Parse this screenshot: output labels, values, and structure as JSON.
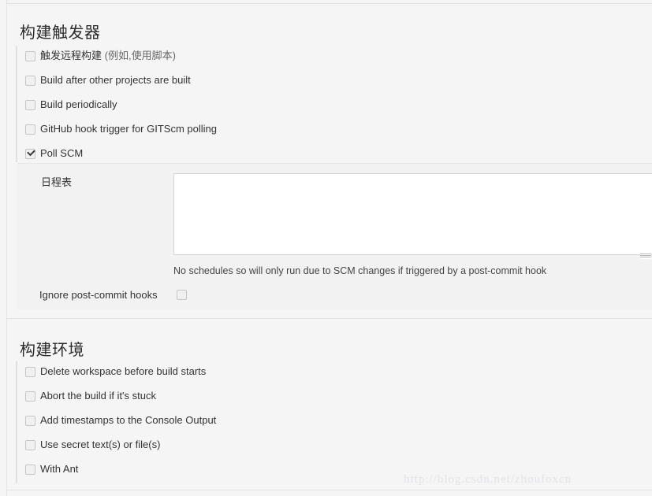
{
  "sections": [
    {
      "heading": "构建触发器",
      "triggers": [
        {
          "label": "触发远程构建 ",
          "label_dim": "(例如,使用脚本)",
          "checked": false
        },
        {
          "label": "Build after other projects are built",
          "label_dim": "",
          "checked": false
        },
        {
          "label": "Build periodically",
          "label_dim": "",
          "checked": false
        },
        {
          "label": "GitHub hook trigger for GITScm polling",
          "label_dim": "",
          "checked": false
        },
        {
          "label": "Poll SCM",
          "label_dim": "",
          "checked": true
        }
      ],
      "poll_scm_panel": {
        "schedule_label": "日程表",
        "schedule_value": "",
        "help_text": "No schedules so will only run due to SCM changes if triggered by a post-commit hook",
        "ignore_hooks_label": "Ignore post-commit hooks",
        "ignore_hooks_checked": false
      }
    },
    {
      "heading": "构建环境",
      "options": [
        {
          "label": "Delete workspace before build starts",
          "checked": false
        },
        {
          "label": "Abort the build if it's stuck",
          "checked": false
        },
        {
          "label": "Add timestamps to the Console Output",
          "checked": false
        },
        {
          "label": "Use secret text(s) or file(s)",
          "checked": false
        },
        {
          "label": "With Ant",
          "checked": false
        }
      ]
    }
  ],
  "watermark": "http://blog.csdn.net/zhoufoxcn",
  "colors": {
    "page_background": "#f5f5f5",
    "panel_background": "#f2f2f2",
    "text": "#333333",
    "border": "#e0e0e0",
    "input_background": "#ffffff",
    "watermark": "#e3e3e8"
  }
}
